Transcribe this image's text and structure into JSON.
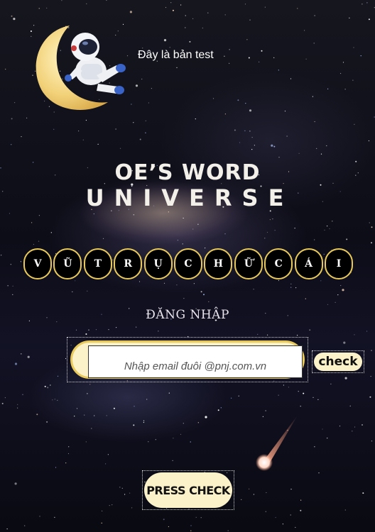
{
  "header": {
    "caption": "Đây là bản test"
  },
  "title": {
    "line1": "OE’S WORD",
    "line2": "UNIVERSE"
  },
  "letters": [
    "V",
    "Ũ",
    "T",
    "R",
    "Ụ",
    "C",
    "H",
    "Ữ",
    "C",
    "Á",
    "I"
  ],
  "login": {
    "heading": "ĐĂNG NHẬP",
    "email_placeholder": "Nhập email đuôi @pnj.com.vn",
    "email_value": "",
    "check_label": "check"
  },
  "actions": {
    "press_check_label": "PRESS CHECK"
  },
  "colors": {
    "accent_gold": "#e8c95a",
    "pill_cream": "#fbf2c9",
    "letter_bg": "#000000"
  },
  "icons": {
    "mascot": "astronaut-on-moon-icon",
    "comet": "comet-icon"
  }
}
